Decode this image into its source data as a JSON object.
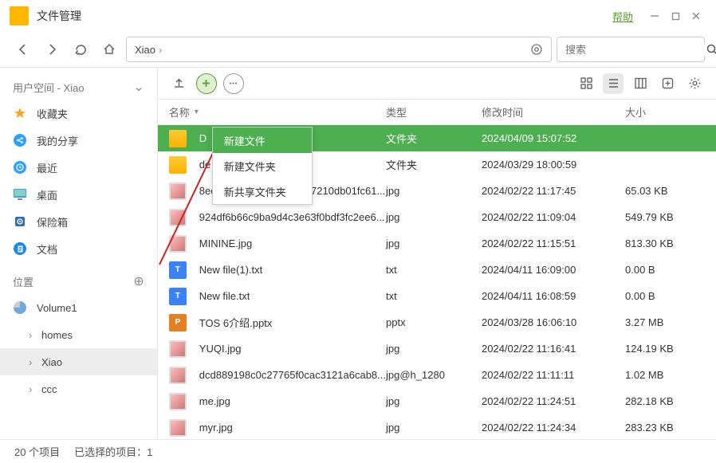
{
  "titlebar": {
    "title": "文件管理",
    "help": "帮助"
  },
  "nav": {
    "address": "Xiao",
    "search_placeholder": "搜索"
  },
  "sidebar": {
    "user_space_label": "用户空间 - Xiao",
    "items": [
      {
        "label": "收藏夹",
        "icon": "star",
        "color": "#f5a623"
      },
      {
        "label": "我的分享",
        "icon": "share",
        "color": "#1e90ff"
      },
      {
        "label": "最近",
        "icon": "clock",
        "color": "#1e90ff"
      },
      {
        "label": "桌面",
        "icon": "desktop",
        "color": "#1e90ff"
      },
      {
        "label": "保险箱",
        "icon": "safe",
        "color": "#1e90ff"
      },
      {
        "label": "文档",
        "icon": "doc",
        "color": "#1e90ff"
      }
    ],
    "location_label": "位置",
    "volume": "Volume1",
    "folders": [
      "homes",
      "Xiao",
      "ccc"
    ],
    "selected_folder": "Xiao"
  },
  "table": {
    "headers": {
      "name": "名称",
      "type": "类型",
      "date": "修改时间",
      "size": "大小"
    },
    "rows": [
      {
        "name": "D",
        "type": "文件夹",
        "date": "2024/04/09 15:07:52",
        "size": "",
        "icon": "folder",
        "selected": true
      },
      {
        "name": "de",
        "type": "文件夹",
        "date": "2024/03/29 18:00:59",
        "size": "",
        "icon": "folder"
      },
      {
        "name": "8ec47e7a7058947487af7210db01fc61...",
        "type": "jpg",
        "date": "2024/02/22 11:17:45",
        "size": "65.03 KB",
        "icon": "thumb"
      },
      {
        "name": "924df6b66c9ba9d4c3e63f0bdf3fc2ee6...",
        "type": "jpg",
        "date": "2024/02/22 11:09:04",
        "size": "549.79 KB",
        "icon": "thumb"
      },
      {
        "name": "MININE.jpg",
        "type": "jpg",
        "date": "2024/02/22 11:15:51",
        "size": "813.30 KB",
        "icon": "thumb"
      },
      {
        "name": "New file(1).txt",
        "type": "txt",
        "date": "2024/04/11 16:09:00",
        "size": "0.00 B",
        "icon": "txt"
      },
      {
        "name": "New file.txt",
        "type": "txt",
        "date": "2024/04/11 16:08:59",
        "size": "0.00 B",
        "icon": "txt"
      },
      {
        "name": "TOS 6介绍.pptx",
        "type": "pptx",
        "date": "2024/03/28 16:06:10",
        "size": "3.27 MB",
        "icon": "pptx"
      },
      {
        "name": "YUQI.jpg",
        "type": "jpg",
        "date": "2024/02/22 11:16:41",
        "size": "124.19 KB",
        "icon": "thumb"
      },
      {
        "name": "dcd889198c0c27765f0cac3121a6cab8...",
        "type": "jpg@h_1280",
        "date": "2024/02/22 11:11:11",
        "size": "1.02 MB",
        "icon": "thumb"
      },
      {
        "name": "me.jpg",
        "type": "jpg",
        "date": "2024/02/22 11:24:51",
        "size": "282.18 KB",
        "icon": "thumb"
      },
      {
        "name": "myr.jpg",
        "type": "jpg",
        "date": "2024/02/22 11:24:34",
        "size": "283.23 KB",
        "icon": "thumb"
      }
    ]
  },
  "context_menu": [
    {
      "label": "新建文件",
      "highlighted": true
    },
    {
      "label": "新建文件夹"
    },
    {
      "label": "新共享文件夹"
    }
  ],
  "status": {
    "count": "20 个项目",
    "selected": "已选择的项目：1"
  }
}
